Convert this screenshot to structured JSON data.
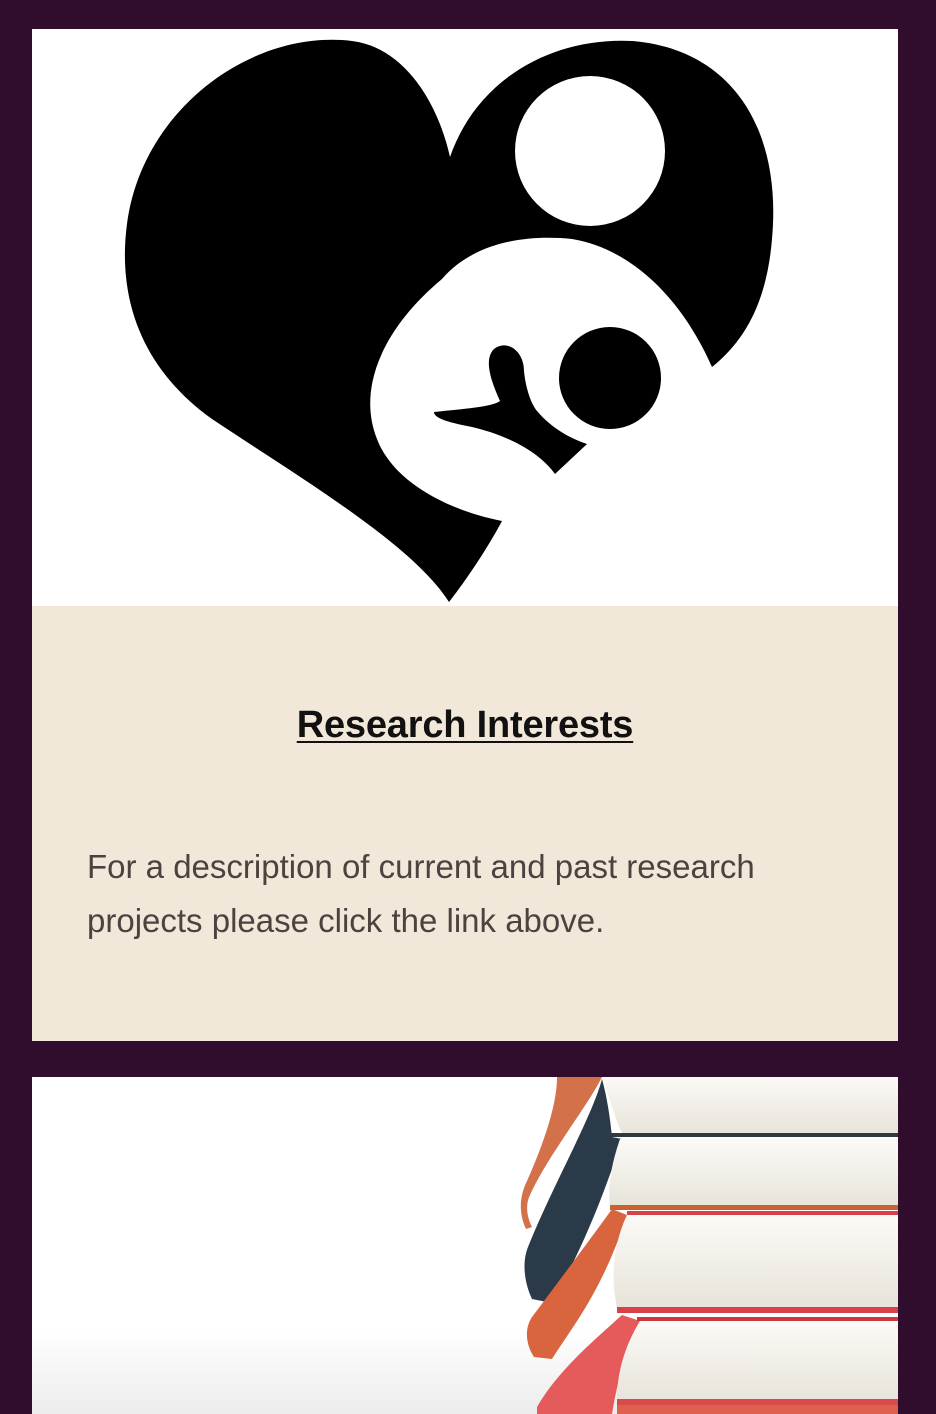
{
  "research_card": {
    "image_icon": "heart-mother-child-logo",
    "title": "Research Interests",
    "description": "For a description of current and past research projects please click the link above."
  },
  "next_card": {
    "image_icon": "book-stack-photo"
  },
  "colors": {
    "page_background": "#300d2c",
    "card_body_background": "#f2e8da",
    "title_text": "#111111",
    "body_text": "#4a4340",
    "logo": "#000000"
  }
}
